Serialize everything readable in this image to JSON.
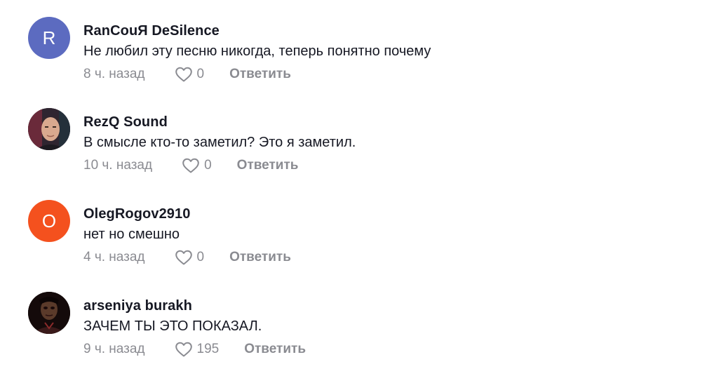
{
  "comments": [
    {
      "avatar_letter": "R",
      "avatar_color": "#5c6bc0",
      "username": "RanCouЯ DeSilence",
      "text": "Не любил эту песню никогда, теперь понятно почему",
      "time": "8 ч. назад",
      "likes": "0",
      "reply": "Ответить"
    },
    {
      "avatar_letter": "",
      "avatar_color": "#3b2f3a",
      "username": "RezQ Sound",
      "text": "В смысле кто-то заметил? Это я заметил.",
      "time": "10 ч. назад",
      "likes": "0",
      "reply": "Ответить"
    },
    {
      "avatar_letter": "O",
      "avatar_color": "#f4511e",
      "username": "OlegRogov2910",
      "text": "нет но смешно",
      "time": "4 ч. назад",
      "likes": "0",
      "reply": "Ответить"
    },
    {
      "avatar_letter": "",
      "avatar_color": "#1a0f0f",
      "username": "arseniya burakh",
      "text": "ЗАЧЕМ ТЫ ЭТО ПОКАЗАЛ.",
      "time": "9 ч. назад",
      "likes": "195",
      "reply": "Ответить"
    }
  ],
  "icons": {
    "like": "heart-outline-icon"
  }
}
